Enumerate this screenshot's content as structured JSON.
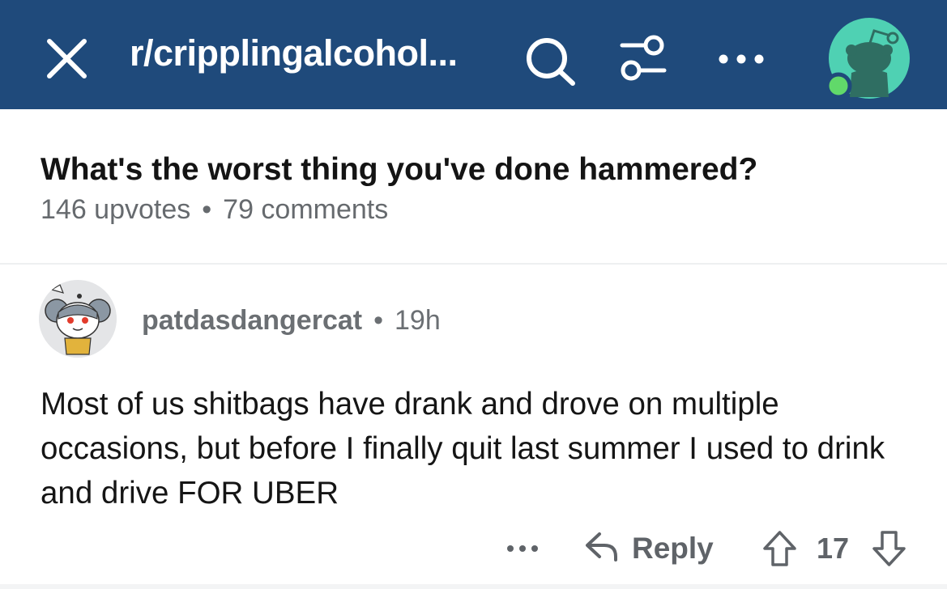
{
  "header": {
    "close_icon": "close-icon",
    "subreddit": "r/cripplingalcohol...",
    "search_icon": "search-icon",
    "filter_icon": "sort-filter-icon",
    "more_icon": "more-horizontal-icon",
    "avatar_icon": "user-avatar-icon",
    "background_color": "#1f4a7b",
    "avatar_color": "#4fd1b3"
  },
  "post": {
    "title": "What's the worst thing you've done hammered?",
    "upvotes": "146 upvotes",
    "separator": "•",
    "comments": "79 comments"
  },
  "comment": {
    "username": "patdasdangercat",
    "separator": "•",
    "age": "19h",
    "body": "Most of us shitbags have drank and drove on multiple occasions, but before I finally quit last summer I used to drink and drive FOR UBER",
    "actions": {
      "more_icon": "more-horizontal-icon",
      "reply_icon": "reply-arrow-icon",
      "reply_label": "Reply",
      "upvote_icon": "upvote-arrow-icon",
      "score": "17",
      "downvote_icon": "downvote-arrow-icon"
    }
  }
}
